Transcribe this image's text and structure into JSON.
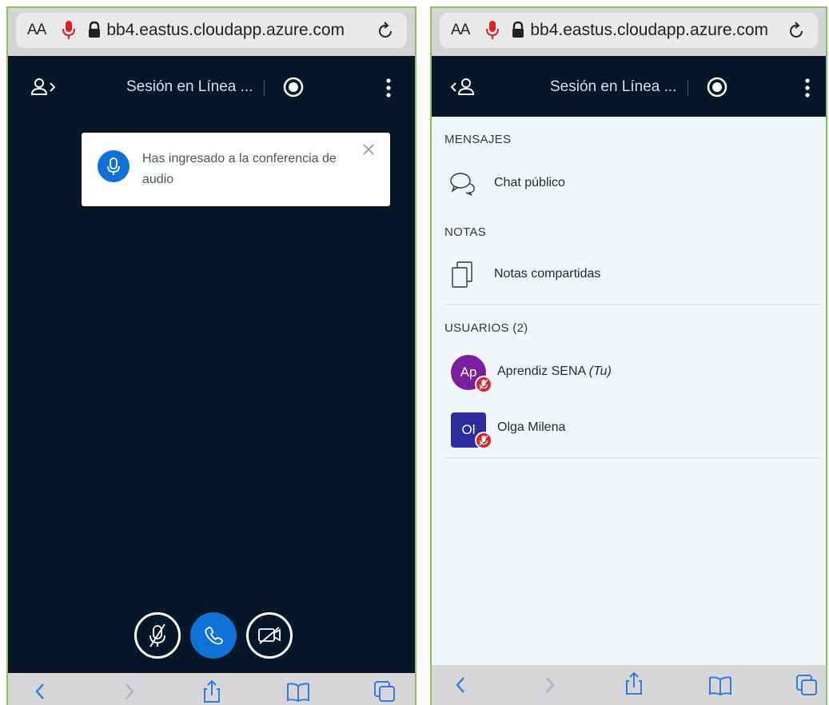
{
  "browser": {
    "text_size_label": "AA",
    "url": "bb4.eastus.cloudapp.azure.com"
  },
  "left": {
    "session_title": "Sesión en Línea ...",
    "toast_message": "Has ingresado a la conferencia de audio"
  },
  "right": {
    "session_title": "Sesión en Línea ...",
    "messages_heading": "MENSAJES",
    "public_chat_label": "Chat público",
    "notes_heading": "NOTAS",
    "shared_notes_label": "Notas compartidas",
    "users_heading": "USUARIOS (2)",
    "users": [
      {
        "initials": "Ap",
        "name": "Aprendiz SENA",
        "tag": "(Tu)"
      },
      {
        "initials": "Ol",
        "name": "Olga Milena",
        "tag": ""
      }
    ]
  },
  "colors": {
    "header_bg": "#06172a",
    "accent_blue": "#0f70d7",
    "muted_red": "#d9262b",
    "avatar_purple": "#7b1fa2",
    "avatar_navy": "#2c2c9e"
  }
}
